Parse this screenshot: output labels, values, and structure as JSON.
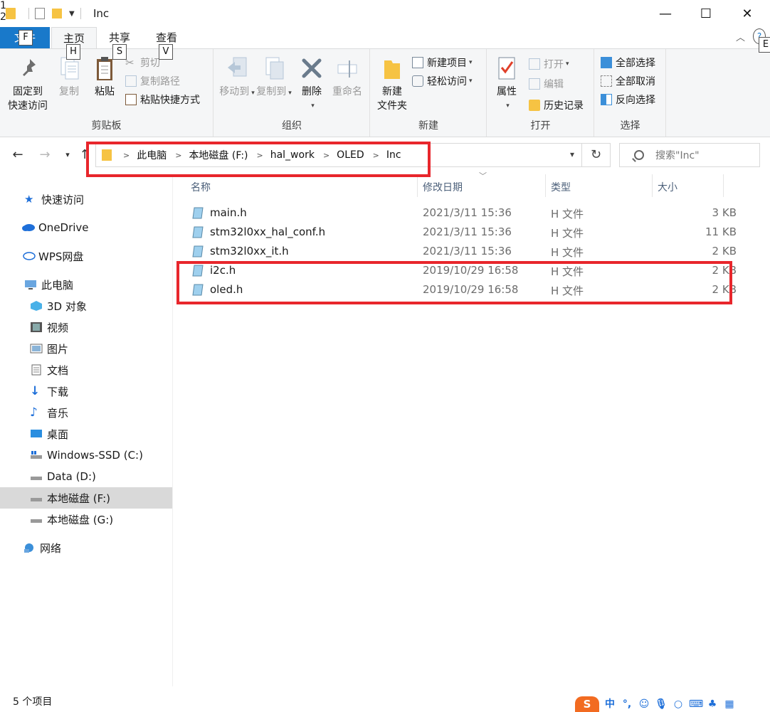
{
  "window": {
    "title": "Inc",
    "qat_keytips": [
      "1",
      "2"
    ],
    "controls": {
      "minimize": "—",
      "maximize": "☐",
      "close": "✕"
    }
  },
  "ribbon_tabs": {
    "file": "文件",
    "file_keytip": "F",
    "home": "主页",
    "home_keytip": "H",
    "share": "共享",
    "share_keytip": "S",
    "view": "查看",
    "view_keytip": "V",
    "help_keytip": "E"
  },
  "ribbon": {
    "clipboard": {
      "label": "剪贴板",
      "pin_line1": "固定到",
      "pin_line2": "快速访问",
      "copy": "复制",
      "paste": "粘贴",
      "cut": "剪切",
      "copy_path": "复制路径",
      "paste_shortcut": "粘贴快捷方式"
    },
    "organize": {
      "label": "组织",
      "move_to": "移动到",
      "copy_to": "复制到",
      "delete": "删除",
      "rename": "重命名"
    },
    "new": {
      "label": "新建",
      "new_folder_line1": "新建",
      "new_folder_line2": "文件夹",
      "new_item": "新建项目",
      "easy_access": "轻松访问"
    },
    "open": {
      "label": "打开",
      "properties": "属性",
      "open": "打开",
      "edit": "编辑",
      "history": "历史记录"
    },
    "select": {
      "label": "选择",
      "select_all": "全部选择",
      "select_none": "全部取消",
      "invert": "反向选择"
    }
  },
  "address": {
    "crumbs": [
      "此电脑",
      "本地磁盘 (F:)",
      "hal_work",
      "OLED",
      "Inc"
    ],
    "search_placeholder": "搜索\"Inc\""
  },
  "sidebar": {
    "items": [
      {
        "label": "快速访问",
        "icon": "star-icon"
      },
      {
        "label": "OneDrive",
        "icon": "cloud-icon"
      },
      {
        "label": "WPS网盘",
        "icon": "wps-cloud-icon"
      },
      {
        "label": "此电脑",
        "icon": "computer-icon"
      },
      {
        "label": "3D 对象",
        "icon": "cube-icon"
      },
      {
        "label": "视频",
        "icon": "film-icon"
      },
      {
        "label": "图片",
        "icon": "picture-icon"
      },
      {
        "label": "文档",
        "icon": "document-icon"
      },
      {
        "label": "下载",
        "icon": "download-icon"
      },
      {
        "label": "音乐",
        "icon": "music-icon"
      },
      {
        "label": "桌面",
        "icon": "desktop-icon"
      },
      {
        "label": "Windows-SSD (C:)",
        "icon": "system-drive-icon"
      },
      {
        "label": "Data (D:)",
        "icon": "drive-icon"
      },
      {
        "label": "本地磁盘 (F:)",
        "icon": "drive-icon",
        "selected": true
      },
      {
        "label": "本地磁盘 (G:)",
        "icon": "drive-icon"
      },
      {
        "label": "网络",
        "icon": "network-icon"
      }
    ]
  },
  "file_list": {
    "columns": [
      "名称",
      "修改日期",
      "类型",
      "大小"
    ],
    "rows": [
      {
        "name": "main.h",
        "date": "2021/3/11 15:36",
        "type": "H 文件",
        "size": "3 KB"
      },
      {
        "name": "stm32l0xx_hal_conf.h",
        "date": "2021/3/11 15:36",
        "type": "H 文件",
        "size": "11 KB"
      },
      {
        "name": "stm32l0xx_it.h",
        "date": "2021/3/11 15:36",
        "type": "H 文件",
        "size": "2 KB"
      },
      {
        "name": "i2c.h",
        "date": "2019/10/29 16:58",
        "type": "H 文件",
        "size": "2 KB"
      },
      {
        "name": "oled.h",
        "date": "2019/10/29 16:58",
        "type": "H 文件",
        "size": "2 KB"
      }
    ]
  },
  "status": {
    "item_count": "5 个项目"
  },
  "tray": {
    "ime": "S",
    "lang": "中"
  },
  "colors": {
    "accent": "#1979ca",
    "highlight_box": "#e8262c",
    "folder": "#f6c343"
  }
}
